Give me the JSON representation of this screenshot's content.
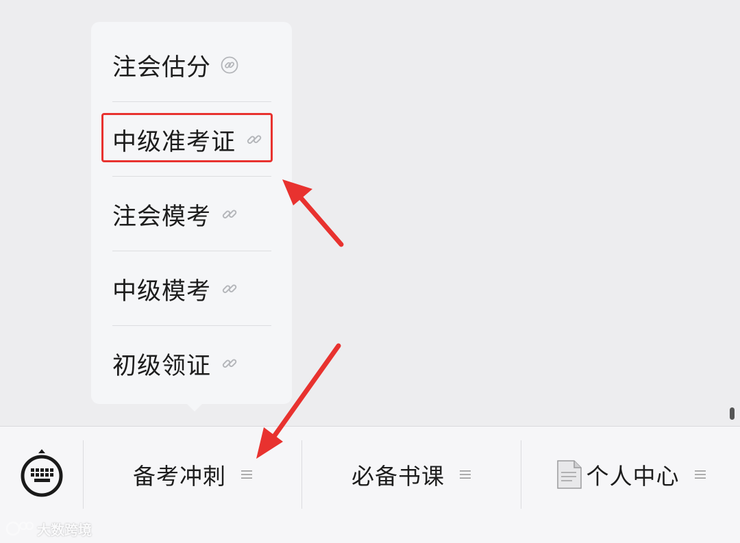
{
  "menu": {
    "items": [
      {
        "label": "注会估分",
        "icon": "link-icon"
      },
      {
        "label": "中级准考证",
        "icon": "link-icon"
      },
      {
        "label": "注会模考",
        "icon": "link-icon"
      },
      {
        "label": "中级模考",
        "icon": "link-icon"
      },
      {
        "label": "初级领证",
        "icon": "link-icon"
      }
    ],
    "highlighted_index": 1
  },
  "bottom_bar": {
    "keyboard_icon": "keyboard-icon",
    "tabs": [
      {
        "label": "备考冲刺",
        "icon": "menu-lines-icon"
      },
      {
        "label": "必备书课",
        "icon": "menu-lines-icon"
      },
      {
        "label": "个人中心",
        "icon": "menu-lines-icon",
        "leading_icon": "document-icon"
      }
    ]
  },
  "watermark": {
    "text": "大数跨境"
  },
  "colors": {
    "annotation_red": "#e8322f",
    "popup_bg": "#f5f6f8",
    "chat_bg": "#ededef",
    "bar_bg": "#f6f6f8"
  }
}
